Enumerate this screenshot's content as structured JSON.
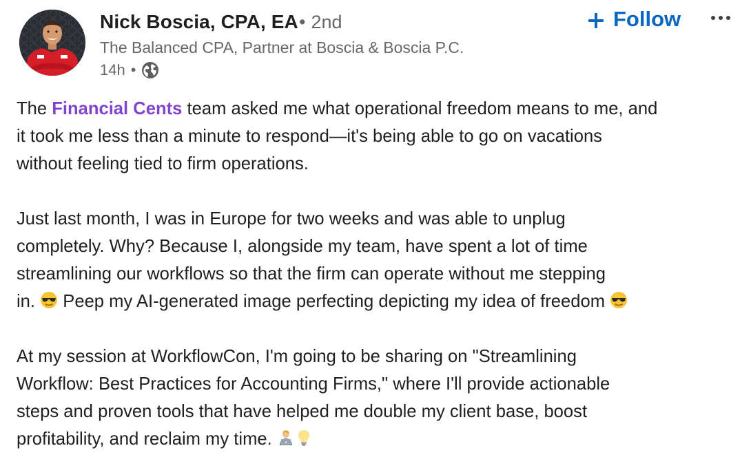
{
  "author": {
    "name": "Nick Boscia, CPA, EA",
    "degree_separator": "•",
    "degree": "2nd",
    "headline": "The Balanced CPA, Partner at Boscia & Boscia P.C.",
    "time_ago": "14h",
    "meta_separator": "•",
    "visibility_icon": "globe-icon"
  },
  "actions": {
    "follow_label": "Follow",
    "follow_icon": "plus-icon",
    "more_icon": "ellipsis-icon"
  },
  "colors": {
    "accent_blue": "#0a66c2",
    "mention_purple": "#8344cc",
    "text_primary": "#1f1f1f",
    "text_secondary": "#666666"
  },
  "post": {
    "p1": {
      "l1_pre": "The ",
      "l1_mention": "Financial Cents",
      "l1_post": " team asked me what operational freedom means to me, and",
      "l2": "it took me less than a minute to respond—it's being able to go on vacations",
      "l3": "without feeling tied to firm operations."
    },
    "p2": {
      "l1": "Just last month, I was in Europe for two weeks and was able to unplug",
      "l2": "completely. Why? Because I, alongside my team, have spent a lot of time",
      "l3": "streamlining our workflows so that the firm can operate without me stepping",
      "l4_pre": "in. ",
      "l4_mid": " Peep my AI-generated image perfecting depicting my idea of freedom ",
      "l4_emoji": "sunglasses-emoji"
    },
    "p3": {
      "l1": "At my session at WorkflowCon, I'm going to be sharing on \"Streamlining",
      "l2": "Workflow: Best Practices for Accounting Firms,\" where I'll provide actionable",
      "l3": "steps and proven tools that have helped me double my client base, boost",
      "l4": "profitability, and reclaim my time. ",
      "l4_emojis": [
        "technologist-emoji",
        "light-bulb-emoji"
      ]
    }
  }
}
